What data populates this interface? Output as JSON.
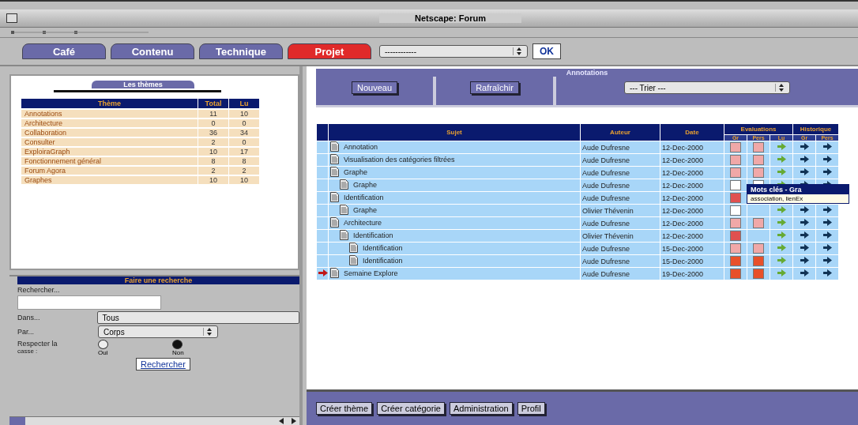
{
  "window": {
    "title": "Netscape: Forum"
  },
  "tabs": [
    {
      "label": "Café",
      "selected": false
    },
    {
      "label": "Contenu",
      "selected": false
    },
    {
      "label": "Technique",
      "selected": false
    },
    {
      "label": "Projet",
      "selected": true
    }
  ],
  "jump_select": {
    "value": "------------"
  },
  "ok_button": "OK",
  "themes": {
    "title": "Les thèmes",
    "columns": [
      "Thème",
      "Total",
      "Lu"
    ],
    "rows": [
      [
        "Annotations",
        "11",
        "10"
      ],
      [
        "Architecture",
        "0",
        "0"
      ],
      [
        "Collaboration",
        "36",
        "34"
      ],
      [
        "Consulter",
        "2",
        "0"
      ],
      [
        "ExploiraGraph",
        "10",
        "17"
      ],
      [
        "Fonctionnement général",
        "8",
        "8"
      ],
      [
        "Forum Agora",
        "2",
        "2"
      ],
      [
        "Graphes",
        "10",
        "10"
      ]
    ]
  },
  "search": {
    "title": "Faire une recherche",
    "query_label": "Rechercher...",
    "in_label": "Dans...",
    "in_value": "Tous",
    "by_label": "Par...",
    "by_value": "Corps",
    "case_label": "Respecter la",
    "case_label_2": "casse :",
    "options": [
      {
        "label": "Oui",
        "selected": false
      },
      {
        "label": "Non",
        "selected": true
      }
    ],
    "button": "Rechercher"
  },
  "annotations": {
    "title": "Annotations",
    "buttons": [
      "Nouveau",
      "Rafraîchir"
    ],
    "sort_select": "--- Trier ---",
    "columns": [
      "Sujet",
      "Auteur",
      "Date"
    ],
    "groups": [
      {
        "label": "Evaluations",
        "sub": [
          "Gr",
          "Pers",
          "Lu"
        ]
      },
      {
        "label": "Historique",
        "sub": [
          "Gr",
          "Pers"
        ]
      }
    ],
    "rows": [
      {
        "subject": "Annotation",
        "author": "Aude Dufresne",
        "date": "12-Dec-2000",
        "ratings": [
          {
            "color": "#f0a8a8"
          },
          {
            "color": "#f0a8a8"
          }
        ],
        "current": false
      },
      {
        "subject": "Visualisation des catégories filtrées",
        "author": "Aude Dufresne",
        "date": "12-Dec-2000",
        "ratings": [
          {
            "color": "#f0a8a8"
          },
          {
            "color": "#f0a8a8"
          }
        ],
        "current": false
      },
      {
        "subject": "Graphe",
        "author": "Aude Dufresne",
        "date": "12-Dec-2000",
        "ratings": [
          {
            "color": "#f0a8a8"
          },
          {
            "color": "#f0a8a8"
          }
        ],
        "current": false,
        "children": [
          {
            "subject": "Graphe",
            "author": "Aude Dufresne",
            "date": "12-Dec-2000",
            "ratings": [
              {
                "color": "#ffffff"
              },
              {
                "color": "#ffffff"
              }
            ],
            "current": false
          }
        ]
      },
      {
        "subject": "Identification",
        "author": "Aude Dufresne",
        "date": "12-Dec-2000",
        "ratings": [
          {
            "color": "#e05050"
          }
        ],
        "current": false,
        "tooltip": {
          "title": "Mots clés - Gra",
          "text": "association, lienEx"
        },
        "children": [
          {
            "subject": "Graphe",
            "author": "Olivier Thévenin",
            "date": "12-Dec-2000",
            "ratings": [
              {
                "color": "#ffffff"
              }
            ],
            "current": false
          }
        ]
      },
      {
        "subject": "Architecture",
        "author": "Aude Dufresne",
        "date": "12-Dec-2000",
        "ratings": [
          {
            "color": "#f0a8a8"
          },
          {
            "color": "#f0a8a8"
          }
        ],
        "current": false,
        "children": [
          {
            "subject": "Identification",
            "author": "Olivier Thévenin",
            "date": "12-Dec-2000",
            "ratings": [
              {
                "color": "#e05050"
              }
            ],
            "current": false,
            "children": [
              {
                "subject": "Identification",
                "author": "Aude Dufresne",
                "date": "15-Dec-2000",
                "ratings": [
                  {
                    "color": "#f0a8a8"
                  },
                  {
                    "color": "#f0a8a8"
                  }
                ],
                "current": false
              },
              {
                "subject": "Identification",
                "author": "Aude Dufresne",
                "date": "15-Dec-2000",
                "ratings": [
                  {
                    "color": "#e8502a"
                  },
                  {
                    "color": "#e8502a"
                  }
                ],
                "current": false
              }
            ]
          }
        ]
      },
      {
        "subject": "Semaine Explore",
        "author": "Aude Dufresne",
        "date": "19-Dec-2000",
        "ratings": [
          {
            "color": "#e8502a"
          },
          {
            "color": "#e8502a"
          }
        ],
        "current": true
      }
    ]
  },
  "footer_buttons": [
    "Créer thème",
    "Créer catégorie",
    "Administration",
    "Profil"
  ]
}
